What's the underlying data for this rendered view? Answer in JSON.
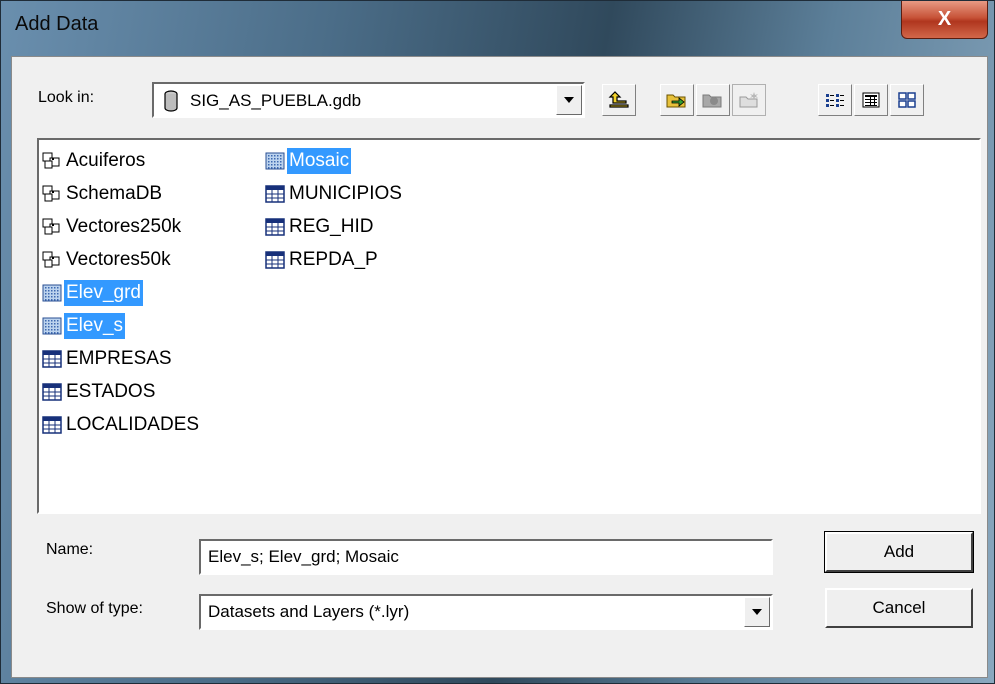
{
  "window": {
    "title": "Add Data",
    "close_glyph": "X"
  },
  "lookin": {
    "label": "Look in:",
    "value": "SIG_AS_PUEBLA.gdb",
    "icon": "database-icon"
  },
  "toolbar": {
    "buttons": [
      {
        "name": "up-one-level-button",
        "icon": "folder-up-icon"
      },
      {
        "name": "connect-folder-button",
        "icon": "connect-folder-icon"
      },
      {
        "name": "disconnect-folder-button",
        "icon": "disconnect-folder-icon"
      },
      {
        "name": "new-folder-button",
        "icon": "new-folder-icon"
      },
      {
        "name": "list-view-button",
        "icon": "list-view-icon"
      },
      {
        "name": "details-view-button",
        "icon": "details-view-icon"
      },
      {
        "name": "thumbnails-view-button",
        "icon": "thumbnails-view-icon"
      }
    ]
  },
  "files": {
    "column1": [
      {
        "label": "Acuiferos",
        "icon": "feature-dataset-icon",
        "selected": false
      },
      {
        "label": "SchemaDB",
        "icon": "feature-dataset-icon",
        "selected": false
      },
      {
        "label": "Vectores250k",
        "icon": "feature-dataset-icon",
        "selected": false
      },
      {
        "label": "Vectores50k",
        "icon": "feature-dataset-icon",
        "selected": false
      },
      {
        "label": "Elev_grd",
        "icon": "raster-icon",
        "selected": true
      },
      {
        "label": "Elev_s",
        "icon": "raster-icon",
        "selected": true
      },
      {
        "label": "EMPRESAS",
        "icon": "table-icon",
        "selected": false
      },
      {
        "label": "ESTADOS",
        "icon": "table-icon",
        "selected": false
      },
      {
        "label": "LOCALIDADES",
        "icon": "table-icon",
        "selected": false
      }
    ],
    "column2": [
      {
        "label": "Mosaic",
        "icon": "raster-icon",
        "selected": true
      },
      {
        "label": "MUNICIPIOS",
        "icon": "table-icon",
        "selected": false
      },
      {
        "label": "REG_HID",
        "icon": "table-icon",
        "selected": false
      },
      {
        "label": "REPDA_P",
        "icon": "table-icon",
        "selected": false
      }
    ]
  },
  "name_field": {
    "label": "Name:",
    "value": "Elev_s; Elev_grd; Mosaic"
  },
  "type_field": {
    "label": "Show of type:",
    "value": "Datasets and Layers (*.lyr)"
  },
  "buttons": {
    "add": "Add",
    "cancel": "Cancel"
  },
  "colors": {
    "selection": "#3399ff",
    "dialog_bg": "#f0f0f0"
  }
}
